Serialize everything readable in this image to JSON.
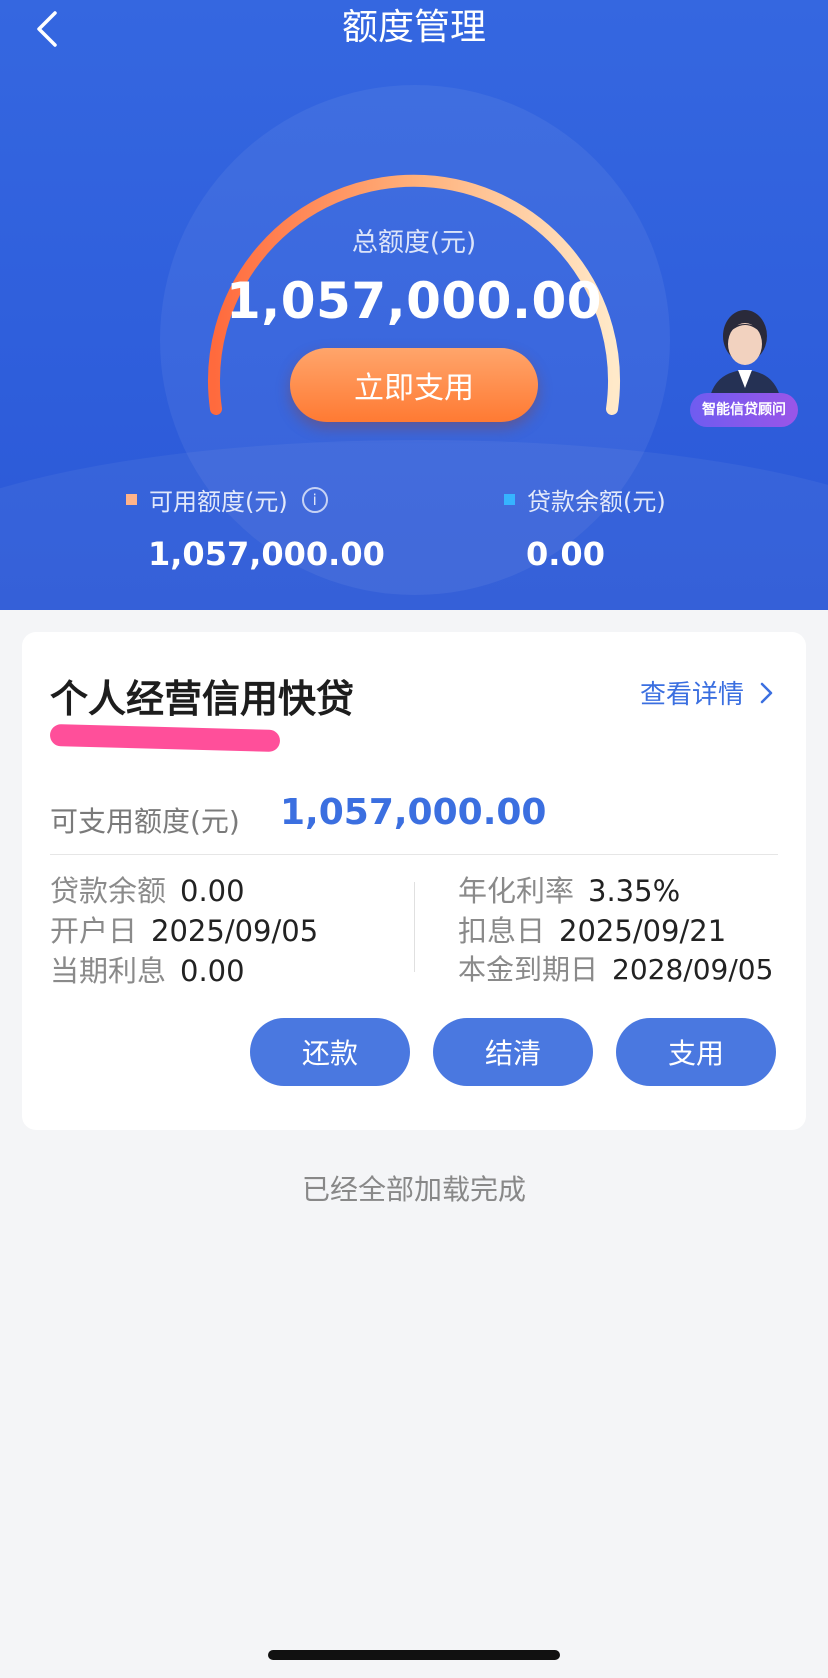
{
  "header": {
    "title": "额度管理",
    "back_icon": "chevron-left-icon"
  },
  "hero": {
    "total_label": "总额度(元)",
    "total_value": "1,057,000.00",
    "use_now_label": "立即支用",
    "advisor_label": "智能信贷顾问",
    "available": {
      "label": "可用额度(元)",
      "value": "1,057,000.00",
      "marker_color": "#ffb38a"
    },
    "balance": {
      "label": "贷款余额(元)",
      "value": "0.00",
      "marker_color": "#36b4ff"
    }
  },
  "product": {
    "name": "个人经营信用快贷",
    "detail_link": "查看详情",
    "available_label": "可支用额度(元)",
    "available_value": "1,057,000.00",
    "fields": {
      "loan_balance": {
        "label": "贷款余额",
        "value": "0.00"
      },
      "open_date": {
        "label": "开户日",
        "value": "2025/09/05"
      },
      "current_interest": {
        "label": "当期利息",
        "value": "0.00"
      },
      "annual_rate": {
        "label": "年化利率",
        "value": "3.35%"
      },
      "interest_date": {
        "label": "扣息日",
        "value": "2025/09/21"
      },
      "maturity_date": {
        "label": "本金到期日",
        "value": "2028/09/05"
      }
    },
    "actions": {
      "repay": "还款",
      "settle": "结清",
      "withdraw": "支用"
    }
  },
  "footer": {
    "loaded_note": "已经全部加载完成"
  },
  "colors": {
    "primary": "#3b6fe0",
    "hero_bg": "#2f5fdc",
    "orange": "#ff7a33"
  }
}
